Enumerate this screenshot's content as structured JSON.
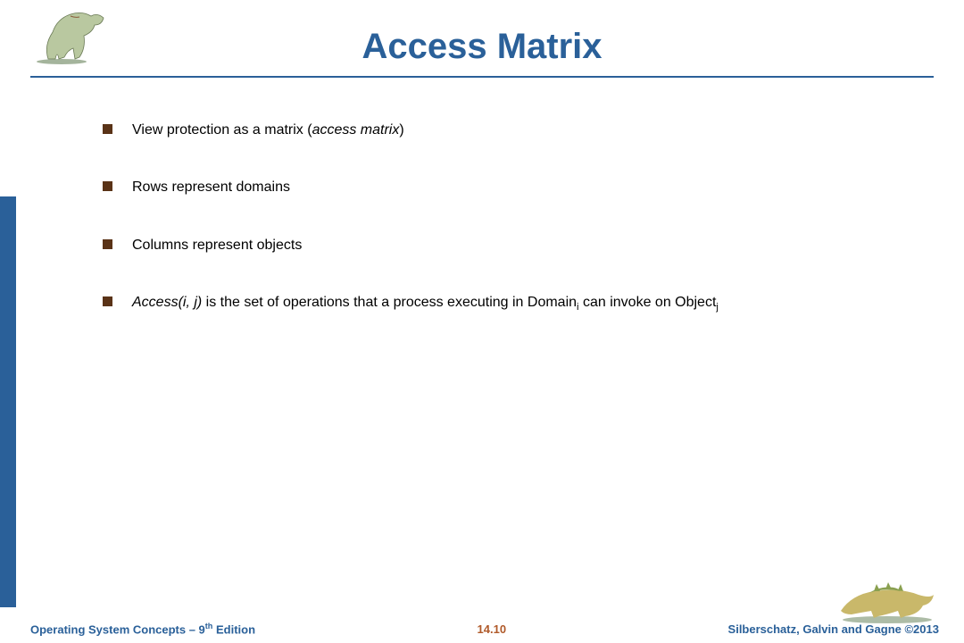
{
  "title": "Access Matrix",
  "bullets": [
    {
      "html": "View protection as a matrix (<em>access matrix</em>)"
    },
    {
      "html": "Rows represent domains"
    },
    {
      "html": "Columns represent objects"
    },
    {
      "html": "<em>Access(i, j)</em> is the set of operations that a process executing in Domain<sub>i</sub> can invoke on Object<sub>j</sub>"
    }
  ],
  "footer": {
    "left_html": "Operating System Concepts – 9<sup>th</sup> Edition",
    "center": "14.10",
    "right": "Silberschatz, Galvin and Gagne ©2013"
  },
  "icons": {
    "top_dino": "dinosaur-upright-icon",
    "bottom_dino": "dinosaur-crouching-icon"
  }
}
